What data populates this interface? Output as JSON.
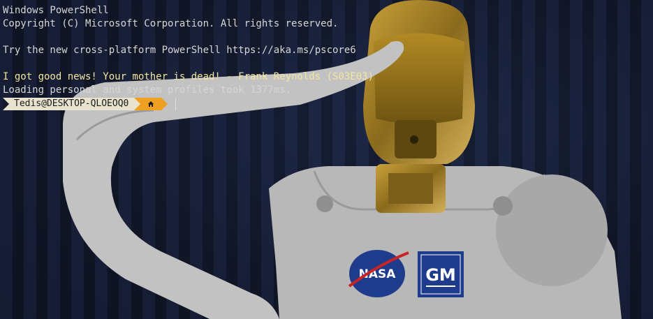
{
  "terminal": {
    "lines": [
      "Windows PowerShell",
      "Copyright (C) Microsoft Corporation. All rights reserved.",
      "",
      "Try the new cross-platform PowerShell https://aka.ms/pscore6",
      "",
      "I got good news! Your mother is dead! - Frank Reynolds (S03E03)",
      "Loading personal and system profiles took 1377ms."
    ],
    "prompt": {
      "user_host": "Tedis@DESKTOP-QLOEOQ0",
      "location_icon": "home-icon"
    }
  },
  "background": {
    "logos": [
      "NASA",
      "GM"
    ]
  },
  "colors": {
    "text": "#d6d6d6",
    "quote": "#f2e6a0",
    "prompt_user_bg": "#e8e3cf",
    "prompt_home_bg": "#f0a020"
  }
}
